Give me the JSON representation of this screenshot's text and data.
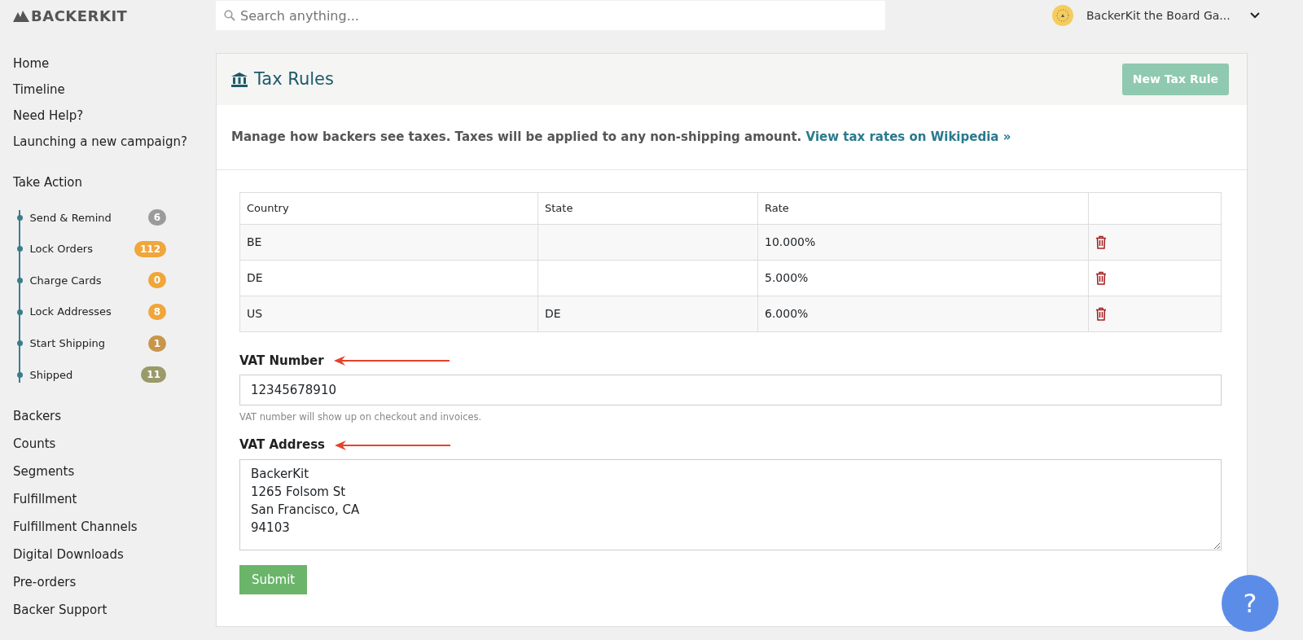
{
  "brand": {
    "name": "BACKERKIT"
  },
  "search": {
    "placeholder": "Search anything..."
  },
  "account": {
    "name": "BackerKit the Board Ga..."
  },
  "nav": [
    "Home",
    "Timeline",
    "Need Help?",
    "Launching a new campaign?"
  ],
  "take_action": {
    "title": "Take Action",
    "steps": [
      {
        "label": "Send & Remind",
        "count": "6",
        "color": "#9b9b9b"
      },
      {
        "label": "Lock Orders",
        "count": "112",
        "color": "#f0a63a"
      },
      {
        "label": "Charge Cards",
        "count": "0",
        "color": "#f0a63a"
      },
      {
        "label": "Lock Addresses",
        "count": "8",
        "color": "#f0a63a"
      },
      {
        "label": "Start Shipping",
        "count": "1",
        "color": "#c8964a"
      },
      {
        "label": "Shipped",
        "count": "11",
        "color": "#9a9a6a"
      }
    ]
  },
  "nav_more": [
    "Backers",
    "Counts",
    "Segments",
    "Fulfillment",
    "Fulfillment Channels",
    "Digital Downloads",
    "Pre-orders",
    "Backer Support"
  ],
  "panel": {
    "title": "Tax Rules",
    "new_button": "New Tax Rule",
    "description": "Manage how backers see taxes. Taxes will be applied to any non-shipping amount.",
    "link": "View tax rates on Wikipedia »"
  },
  "table": {
    "columns": [
      "Country",
      "State",
      "Rate"
    ],
    "rows": [
      {
        "country": "BE",
        "state": "",
        "rate": "10.000%"
      },
      {
        "country": "DE",
        "state": "",
        "rate": "5.000%"
      },
      {
        "country": "US",
        "state": "DE",
        "rate": "6.000%"
      }
    ]
  },
  "vat_number": {
    "label": "VAT Number",
    "value": "12345678910",
    "help": "VAT number will show up on checkout and invoices."
  },
  "vat_address": {
    "label": "VAT Address",
    "value": "BackerKit\n1265 Folsom St\nSan Francisco, CA\n94103"
  },
  "submit": "Submit",
  "help_bubble": "?"
}
